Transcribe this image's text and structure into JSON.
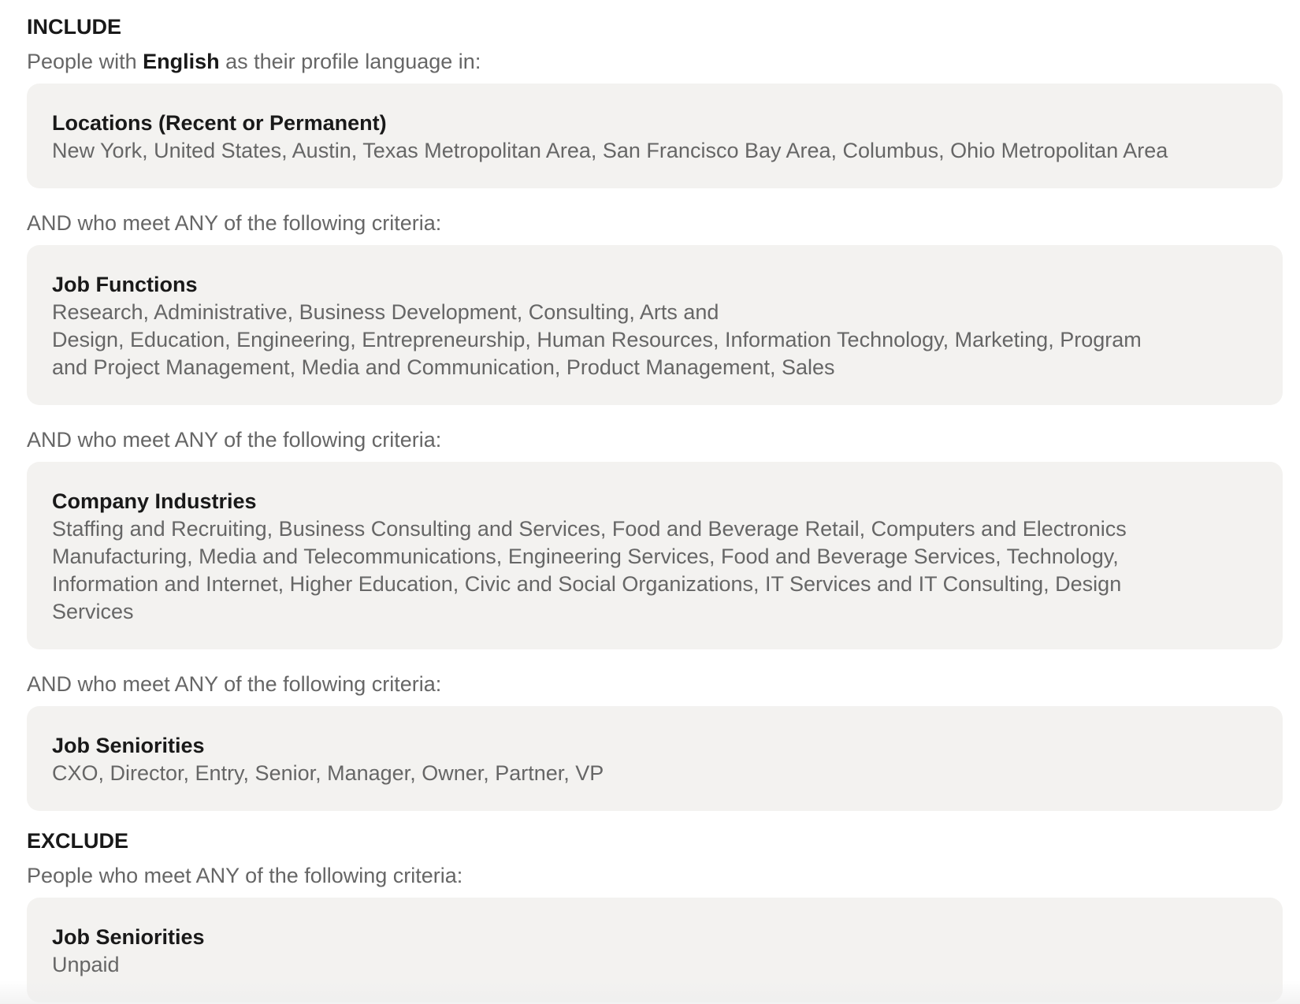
{
  "include": {
    "heading": "INCLUDE",
    "intro_prefix": "People with ",
    "intro_language": "English",
    "intro_suffix": " as their profile language in:",
    "locations": {
      "title": "Locations (Recent or Permanent)",
      "values": "New York, United States, Austin, Texas Metropolitan Area, San Francisco Bay Area, Columbus, Ohio Metropolitan Area"
    },
    "criteria_label_1": "AND who meet ANY of the following criteria:",
    "job_functions": {
      "title": "Job Functions",
      "values": "Research, Administrative, Business Development, Consulting, Arts and\nDesign, Education, Engineering, Entrepreneurship, Human Resources, Information Technology, Marketing, Program\nand Project Management, Media and Communication, Product Management, Sales"
    },
    "criteria_label_2": "AND who meet ANY of the following criteria:",
    "company_industries": {
      "title": "Company Industries",
      "values": "Staffing and Recruiting, Business Consulting and Services, Food and Beverage Retail, Computers and Electronics\nManufacturing, Media and Telecommunications, Engineering Services, Food and Beverage Services, Technology,\nInformation and Internet, Higher Education, Civic and Social Organizations, IT Services and IT Consulting, Design\nServices"
    },
    "criteria_label_3": "AND who meet ANY of the following criteria:",
    "job_seniorities": {
      "title": "Job Seniorities",
      "values": "CXO, Director, Entry, Senior, Manager, Owner, Partner, VP"
    }
  },
  "exclude": {
    "heading": "EXCLUDE",
    "intro": "People who meet ANY of the following criteria:",
    "job_seniorities": {
      "title": "Job Seniorities",
      "values": "Unpaid"
    }
  }
}
